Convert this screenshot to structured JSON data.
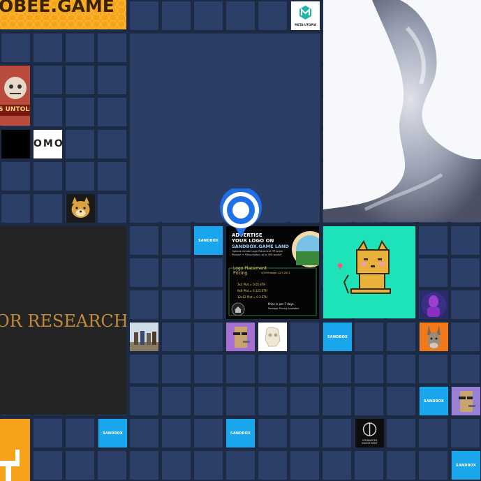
{
  "map": {
    "colors": {
      "background": "#1d2a44",
      "empty_parcel": "#2b3f68",
      "estate": "#2a3e66",
      "sandbox_blue": "#1aa6ec",
      "pin_blue": "#1f6fe6",
      "honey": "#f6a51a",
      "cat_teal": "#1fe3b8",
      "research_dark": "#242424",
      "research_gold": "#c08a3a"
    },
    "blocks": {
      "bee_game": {
        "label": "OBEE.GAME"
      },
      "meta_utopia": {
        "label": "META-UTOPIA"
      },
      "untold": {
        "label": "S UNTOLD"
      },
      "omo": {
        "label": "OMO"
      },
      "research": {
        "label": "OR RESEARCH"
      },
      "openwater": {
        "label": "OPENWATER INVESTMENT"
      }
    },
    "sandbox_label": "SANDBOX",
    "advert": {
      "headline_1": "ADVERTISE",
      "headline_2": "YOUR LOGO ON",
      "headline_3": "SANDBOX.GAME LAND",
      "options": "Options include Logo Placement *Preview Photos* + *Description up to 300 words*",
      "pricing_title": "Logo Placement",
      "pricing_sub": "Pricing",
      "pricing_dates": "9/19 through 12/3 2021",
      "price_1": "3x3 Plot = 0.05 ETH",
      "price_2": "6x6 Plot = 0.125 ETH",
      "price_3": "12x12 Plot = 0.3 ETH",
      "note_1": "Price is per 7 days.",
      "note_2": "Package Pricing Available"
    }
  }
}
